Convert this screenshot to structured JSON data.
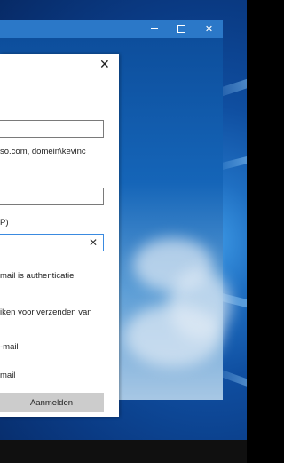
{
  "window": {
    "minimize_icon": "minimize-icon",
    "maximize_icon": "maximize-icon",
    "close_icon": "close-icon"
  },
  "dialog": {
    "close_glyph": "✕",
    "field_hint": "so.com, domein\\kevinc",
    "port_label_fragment": "P)",
    "clear_glyph": "✕",
    "auth_text": "mail is authenticatie",
    "smtp_text": "iken voor verzenden van",
    "mail_text_1": "-mail",
    "mail_text_2": "mail",
    "signin_button": "Aanmelden"
  },
  "colors": {
    "titlebar": "#2b78c8",
    "button": "#cccccc",
    "active_border": "#3a8ae0"
  }
}
